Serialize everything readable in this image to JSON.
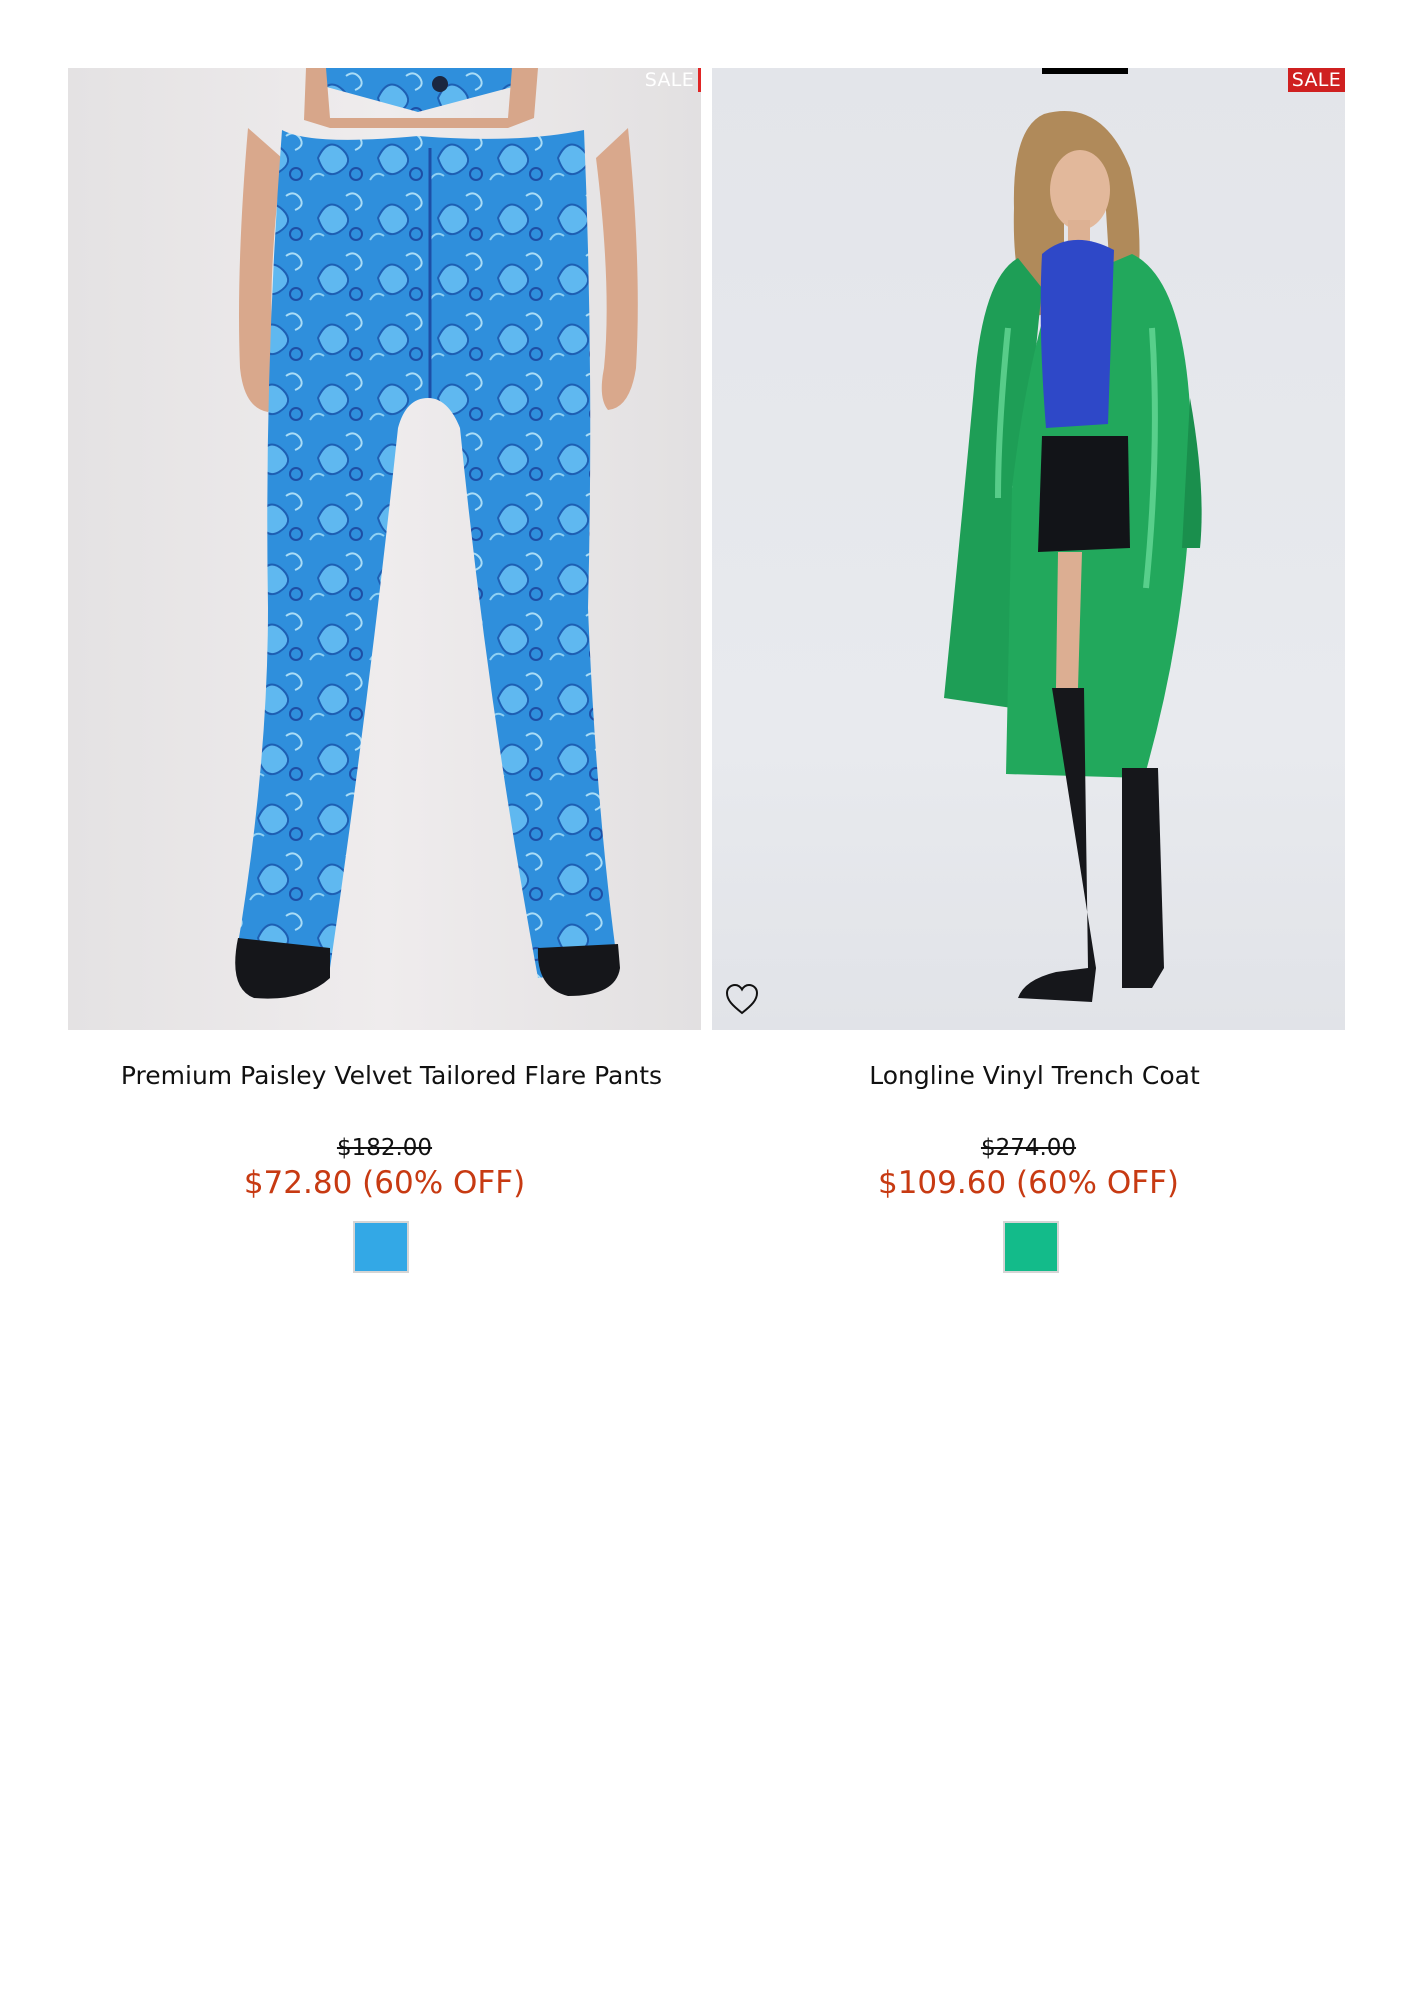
{
  "products": [
    {
      "title": "Premium Paisley Velvet Tailored Flare Pants",
      "badge": "SALE",
      "original_price": "$182.00",
      "sale_price": "$72.80 (60% OFF)",
      "swatch_color": "#33a8e6",
      "image_icon": "product-photo-paisley-pants"
    },
    {
      "title": "Longline Vinyl Trench Coat",
      "badge": "SALE",
      "original_price": "$274.00",
      "sale_price": "$109.60 (60% OFF)",
      "swatch_color": "#13bb8a",
      "image_icon": "product-photo-green-trench",
      "wishlist_icon": "heart-icon"
    }
  ],
  "colors": {
    "sale_price": "#c73a12",
    "sale_badge": "#cf2020"
  }
}
